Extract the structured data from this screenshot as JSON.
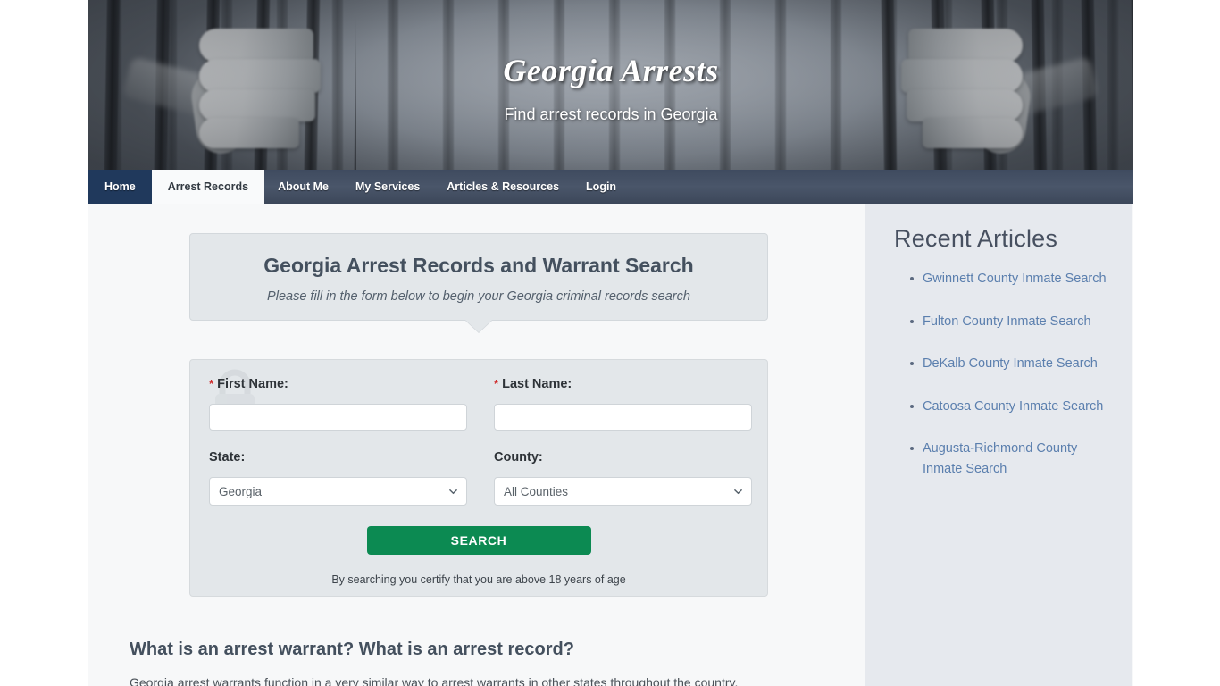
{
  "site": {
    "title": "Georgia Arrests",
    "tagline": "Find arrest records in Georgia"
  },
  "nav": {
    "items": [
      {
        "label": "Home",
        "state": "home"
      },
      {
        "label": "Arrest Records",
        "state": "active"
      },
      {
        "label": "About Me",
        "state": "normal"
      },
      {
        "label": "My Services",
        "state": "normal"
      },
      {
        "label": "Articles & Resources",
        "state": "normal"
      },
      {
        "label": "Login",
        "state": "normal"
      }
    ]
  },
  "callout": {
    "heading": "Georgia Arrest Records and Warrant Search",
    "subheading": "Please fill in the form below to begin your Georgia criminal records search"
  },
  "form": {
    "first_name": {
      "label": "First Name:",
      "required_marker": "*",
      "value": "",
      "placeholder": ""
    },
    "last_name": {
      "label": "Last Name:",
      "required_marker": "*",
      "value": "",
      "placeholder": ""
    },
    "state": {
      "label": "State:",
      "selected": "Georgia",
      "options": [
        "Georgia"
      ]
    },
    "county": {
      "label": "County:",
      "selected": "All Counties",
      "options": [
        "All Counties"
      ]
    },
    "search_button": "SEARCH",
    "disclaimer": "By searching you certify that you are above 18 years of age"
  },
  "article": {
    "heading": "What is an arrest warrant? What is an arrest record?",
    "paragraph": "Georgia arrest warrants function in a very similar way to arrest warrants in other states throughout the country."
  },
  "sidebar": {
    "heading": "Recent Articles",
    "links": [
      "Gwinnett County Inmate Search",
      "Fulton County Inmate Search",
      "DeKalb County Inmate Search",
      "Catoosa County Inmate Search",
      "Augusta-Richmond County Inmate Search"
    ]
  },
  "colors": {
    "nav_bg": "#37445a",
    "nav_home_bg": "#20395c",
    "search_button": "#0c8a52",
    "panel_bg": "#e3e7ea",
    "sidebar_bg": "#e6e9ee",
    "link": "#5b7fae",
    "heading": "#44505e",
    "required_asterisk": "#cf2b2b"
  }
}
